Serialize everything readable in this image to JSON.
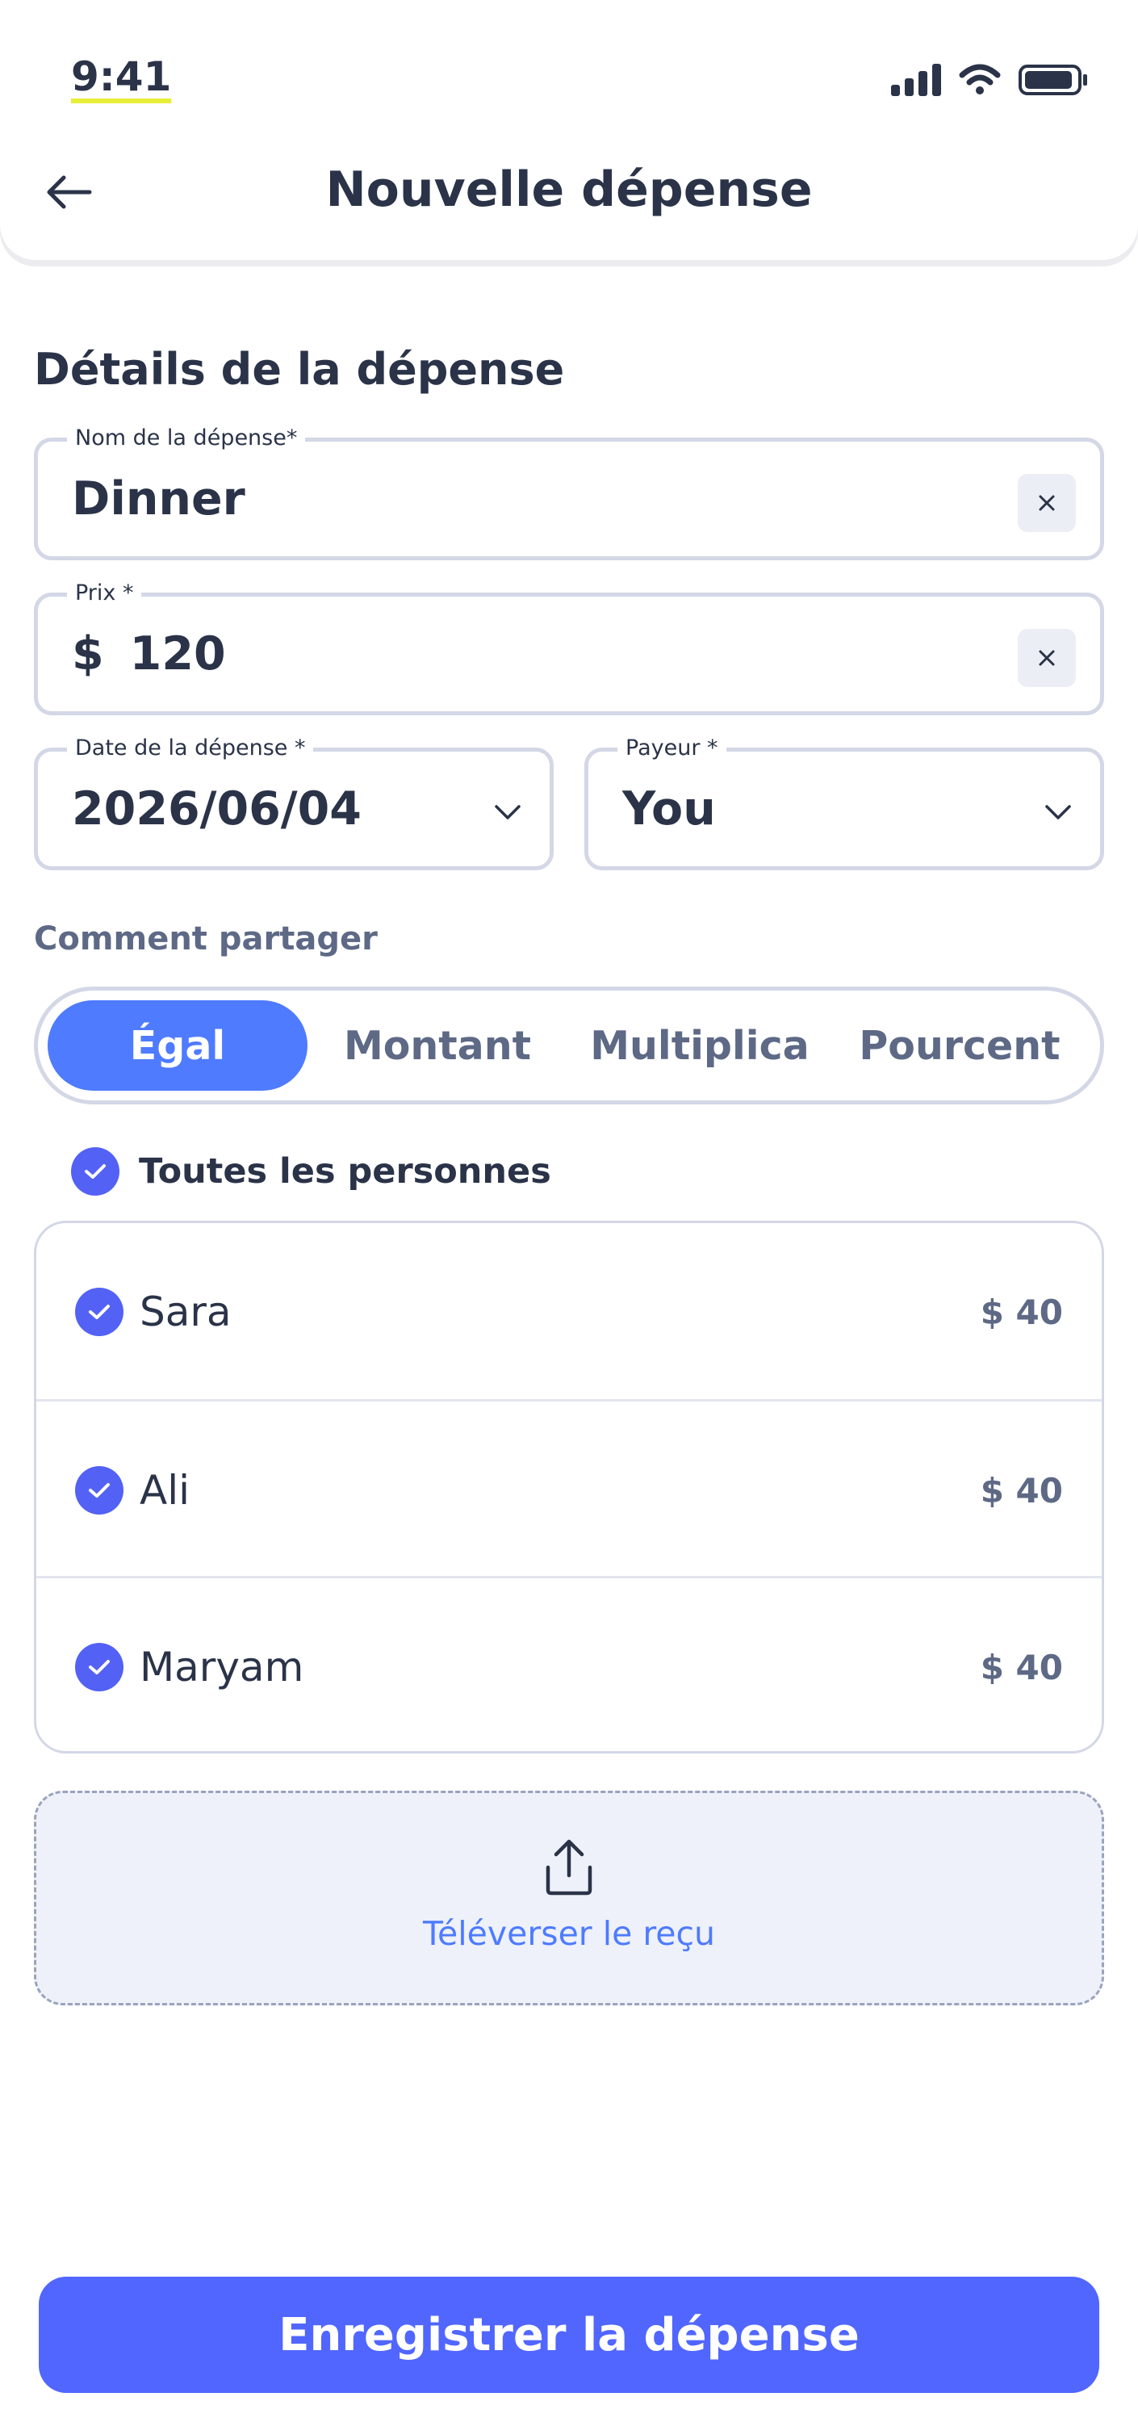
{
  "status_bar": {
    "time": "9:41"
  },
  "header": {
    "title": "Nouvelle dépense"
  },
  "section_title": "Détails de la dépense",
  "fields": {
    "name": {
      "label": "Nom de la dépense*",
      "value": "Dinner"
    },
    "price": {
      "label": "Prix *",
      "currency": "$",
      "value": "120"
    },
    "date": {
      "label": "Date de la dépense *",
      "value": "2026/06/04"
    },
    "payer": {
      "label": "Payeur *",
      "value": "You"
    }
  },
  "split": {
    "label": "Comment partager",
    "options": [
      "Égal",
      "Montant",
      "Multiplica",
      "Pourcent"
    ],
    "selected": "Égal"
  },
  "all_persons": {
    "label": "Toutes les personnes",
    "checked": true
  },
  "members": [
    {
      "name": "Sara",
      "amount": "$ 40",
      "checked": true
    },
    {
      "name": "Ali",
      "amount": "$ 40",
      "checked": true
    },
    {
      "name": "Maryam",
      "amount": "$ 40",
      "checked": true
    }
  ],
  "upload": {
    "label": "Téléverser le reçu",
    "icon": "upload-icon"
  },
  "save_button": {
    "label": "Enregistrer la dépense"
  },
  "colors": {
    "accent": "#4e7bff",
    "primary_button": "#5166ff",
    "check": "#5361f5",
    "text_dark": "#2a3348",
    "text_muted": "#5d6985",
    "border": "#d3d7e6"
  }
}
